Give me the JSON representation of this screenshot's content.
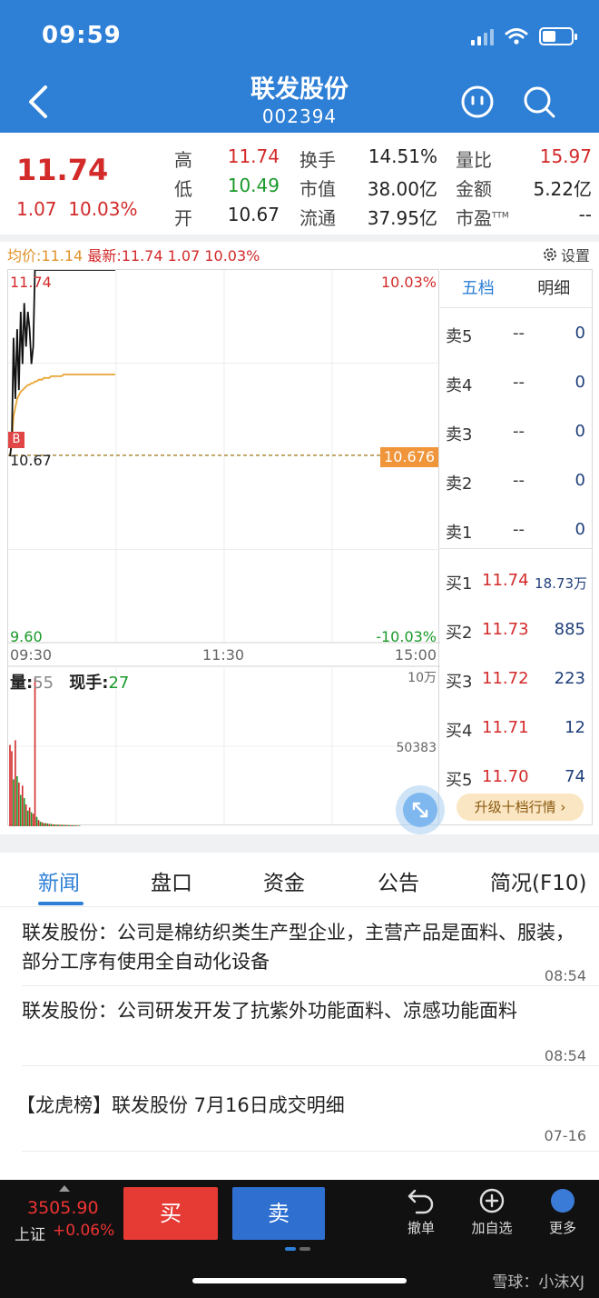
{
  "status": {
    "time": "09:59"
  },
  "header": {
    "title": "联发股份",
    "code": "002394"
  },
  "quote": {
    "price": "11.74",
    "change": "1.07",
    "change_pct": "10.03%",
    "fields": [
      {
        "label": "高",
        "value": "11.74",
        "color": "red"
      },
      {
        "label": "换手",
        "value": "14.51%",
        "color": "dark"
      },
      {
        "label": "量比",
        "value": "15.97",
        "color": "red"
      },
      {
        "label": "低",
        "value": "10.49",
        "color": "green"
      },
      {
        "label": "市值",
        "value": "38.00亿",
        "color": "dark"
      },
      {
        "label": "金额",
        "value": "5.22亿",
        "color": "dark"
      },
      {
        "label": "开",
        "value": "10.67",
        "color": "dark"
      },
      {
        "label": "流通",
        "value": "37.95亿",
        "color": "dark"
      },
      {
        "label": "市盈",
        "value": "--",
        "color": "dark",
        "sup": "TTM"
      }
    ]
  },
  "info_line": {
    "avg_label": "均价:",
    "avg_value": "11.14",
    "latest_label": "最新:",
    "latest_value": "11.74",
    "latest_change": "1.07",
    "latest_pct": "10.03%"
  },
  "settings_label": "设置",
  "chart_data": {
    "type": "line",
    "x_ticks": [
      "09:30",
      "11:30",
      "15:00"
    ],
    "y_top_left": "11.74",
    "y_top_right": "10.03%",
    "y_bottom_left": "9.60",
    "y_bottom_right": "-10.03%",
    "ylim": [
      9.6,
      11.74
    ],
    "prev_close": 10.676,
    "prev_close_label": "10.676",
    "open_label": "10.67",
    "buy_marker": "B",
    "price_series": [
      10.67,
      10.75,
      11.35,
      11.0,
      11.4,
      11.05,
      11.5,
      11.2,
      11.55,
      11.3,
      11.5,
      11.4,
      11.2,
      11.3,
      11.74,
      11.74,
      11.74,
      11.74,
      11.74,
      11.74,
      11.74,
      11.74,
      11.74,
      11.74,
      11.74,
      11.74,
      11.74,
      11.74,
      11.74,
      11.74,
      11.74,
      11.74,
      11.74,
      11.74,
      11.74,
      11.74,
      11.74,
      11.74,
      11.74,
      11.74,
      11.74,
      11.74,
      11.74,
      11.74,
      11.74,
      11.74,
      11.74,
      11.74,
      11.74,
      11.74,
      11.74,
      11.74,
      11.74,
      11.74,
      11.74,
      11.74,
      11.74,
      11.74,
      11.74,
      11.74
    ],
    "avg_series": [
      10.67,
      10.74,
      10.9,
      10.95,
      11.0,
      11.02,
      11.04,
      11.05,
      11.06,
      11.07,
      11.08,
      11.08,
      11.09,
      11.09,
      11.1,
      11.1,
      11.11,
      11.11,
      11.11,
      11.12,
      11.12,
      11.12,
      11.12,
      11.13,
      11.13,
      11.13,
      11.13,
      11.13,
      11.13,
      11.13,
      11.14,
      11.14,
      11.14,
      11.14,
      11.14,
      11.14,
      11.14,
      11.14,
      11.14,
      11.14,
      11.14,
      11.14,
      11.14,
      11.14,
      11.14,
      11.14,
      11.14,
      11.14,
      11.14,
      11.14,
      11.14,
      11.14,
      11.14,
      11.14,
      11.14,
      11.14,
      11.14,
      11.14,
      11.14,
      11.14
    ],
    "total_minutes": 241,
    "volume": {
      "label": "量:",
      "value": "55",
      "hand_label": "现手:",
      "hand_value": "27",
      "top_label": "10万",
      "mid_label": "50383",
      "max": 100000,
      "bars": [
        52000,
        48000,
        30000,
        55000,
        32000,
        28000,
        20000,
        26000,
        18000,
        14000,
        10000,
        12000,
        9000,
        8000,
        95000,
        6000,
        4000,
        3000,
        2500,
        2000,
        2000,
        1800,
        1500,
        1500,
        1200,
        1200,
        1000,
        1000,
        900,
        900,
        800,
        800,
        700,
        700,
        600,
        600,
        500,
        500,
        400,
        400
      ],
      "bar_colors": [
        "red",
        "red",
        "green",
        "red",
        "green",
        "red",
        "green",
        "red",
        "green",
        "red",
        "green",
        "red",
        "green",
        "red",
        "red",
        "green",
        "red",
        "green",
        "red",
        "green",
        "red",
        "green",
        "red",
        "green",
        "red",
        "green",
        "red",
        "green",
        "red",
        "green",
        "red",
        "green",
        "red",
        "green",
        "red",
        "green",
        "red",
        "green",
        "red",
        "green"
      ]
    }
  },
  "order_book": {
    "tabs": [
      "五档",
      "明细"
    ],
    "asks": [
      {
        "label": "卖5",
        "price": "--",
        "vol": "0"
      },
      {
        "label": "卖4",
        "price": "--",
        "vol": "0"
      },
      {
        "label": "卖3",
        "price": "--",
        "vol": "0"
      },
      {
        "label": "卖2",
        "price": "--",
        "vol": "0"
      },
      {
        "label": "卖1",
        "price": "--",
        "vol": "0"
      }
    ],
    "bids": [
      {
        "label": "买1",
        "price": "11.74",
        "vol": "18.73万"
      },
      {
        "label": "买2",
        "price": "11.73",
        "vol": "885"
      },
      {
        "label": "买3",
        "price": "11.72",
        "vol": "223"
      },
      {
        "label": "买4",
        "price": "11.71",
        "vol": "12"
      },
      {
        "label": "买5",
        "price": "11.70",
        "vol": "74"
      }
    ],
    "upgrade_label": "升级十档行情 ›"
  },
  "tabs": [
    "新闻",
    "盘口",
    "资金",
    "公告",
    "简况(F10)"
  ],
  "news": [
    {
      "text": "联发股份：公司是棉纺织类生产型企业，主营产品是面料、服装，部分工序有使用全自动化设备",
      "time": "08:54"
    },
    {
      "text": "联发股份：公司研发开发了抗紫外功能面料、凉感功能面料",
      "time": "08:54"
    },
    {
      "text": "【龙虎榜】联发股份 7月16日成交明细",
      "time": "07-16"
    }
  ],
  "bottom": {
    "index_value": "3505.90",
    "index_name": "上证",
    "index_change": "+0.06%",
    "buy_label": "买",
    "sell_label": "卖",
    "actions": [
      "撤单",
      "加自选",
      "更多"
    ],
    "watermark": "雪球：小沫XJ"
  },
  "colors": {
    "primary": "#2e7fd6",
    "up": "#d32a2a",
    "down": "#1a9a2a",
    "avg_line": "#e8a534",
    "prev_close_tag": "#f0953a"
  }
}
